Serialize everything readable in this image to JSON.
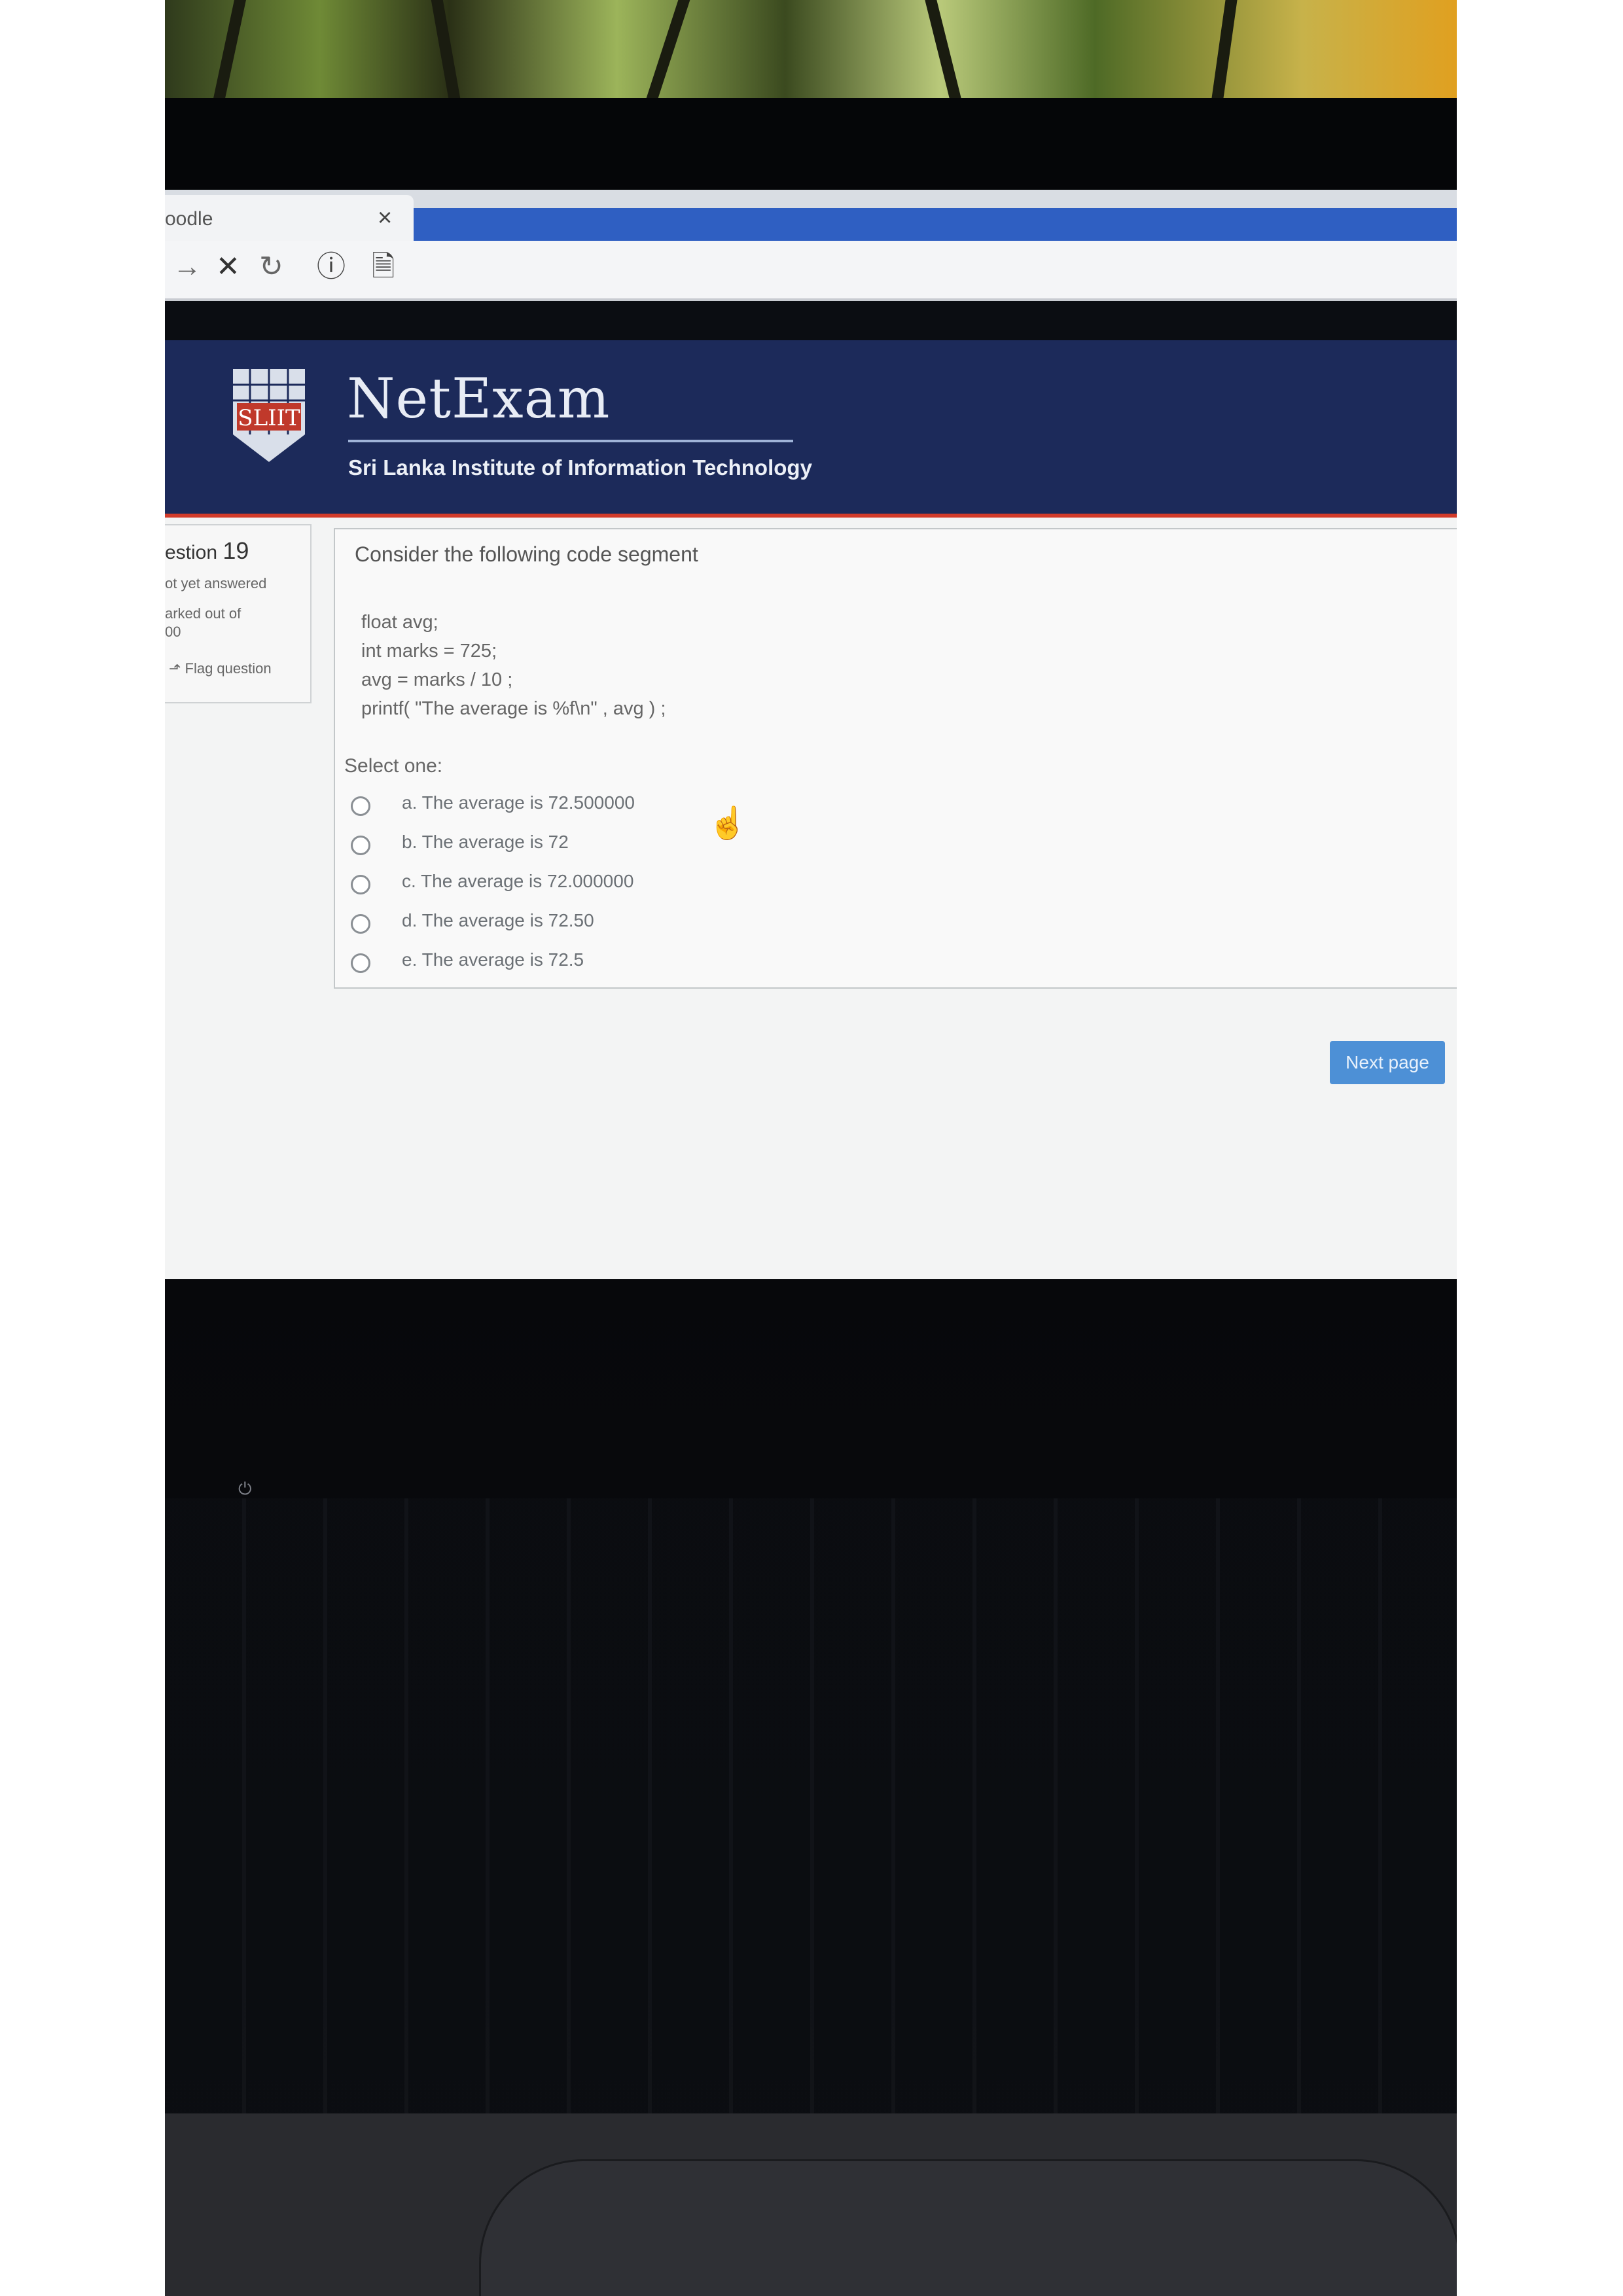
{
  "browser": {
    "tab_title": "oodle",
    "tab_close": "×",
    "nav_icons": [
      "→",
      "✕",
      "↻",
      "ⓘ",
      "🗎"
    ]
  },
  "header": {
    "brand": "NetExam",
    "subtitle": "Sri Lanka Institute of Information Technology",
    "logo_text": "SLIIT",
    "colors": {
      "band": "#1c2a5a",
      "accent": "#d23b2a"
    }
  },
  "info": {
    "question_prefix": "estion",
    "question_number": "19",
    "status": "ot yet answered",
    "marked_line1": "arked out of",
    "marked_line2": "00",
    "flag": "Flag question"
  },
  "question": {
    "prompt": "Consider the following code segment",
    "code_lines": [
      "float avg;",
      "int marks = 725;",
      "avg = marks / 10 ;",
      "printf( \"The average is %f\\n\" , avg ) ;"
    ],
    "select_label": "Select one:",
    "options": [
      "a. The average is 72.500000",
      "b. The average is 72",
      "c. The average is 72.000000",
      "d. The average is 72.50",
      "e. The average is 72.5"
    ]
  },
  "next_button": "Next page"
}
